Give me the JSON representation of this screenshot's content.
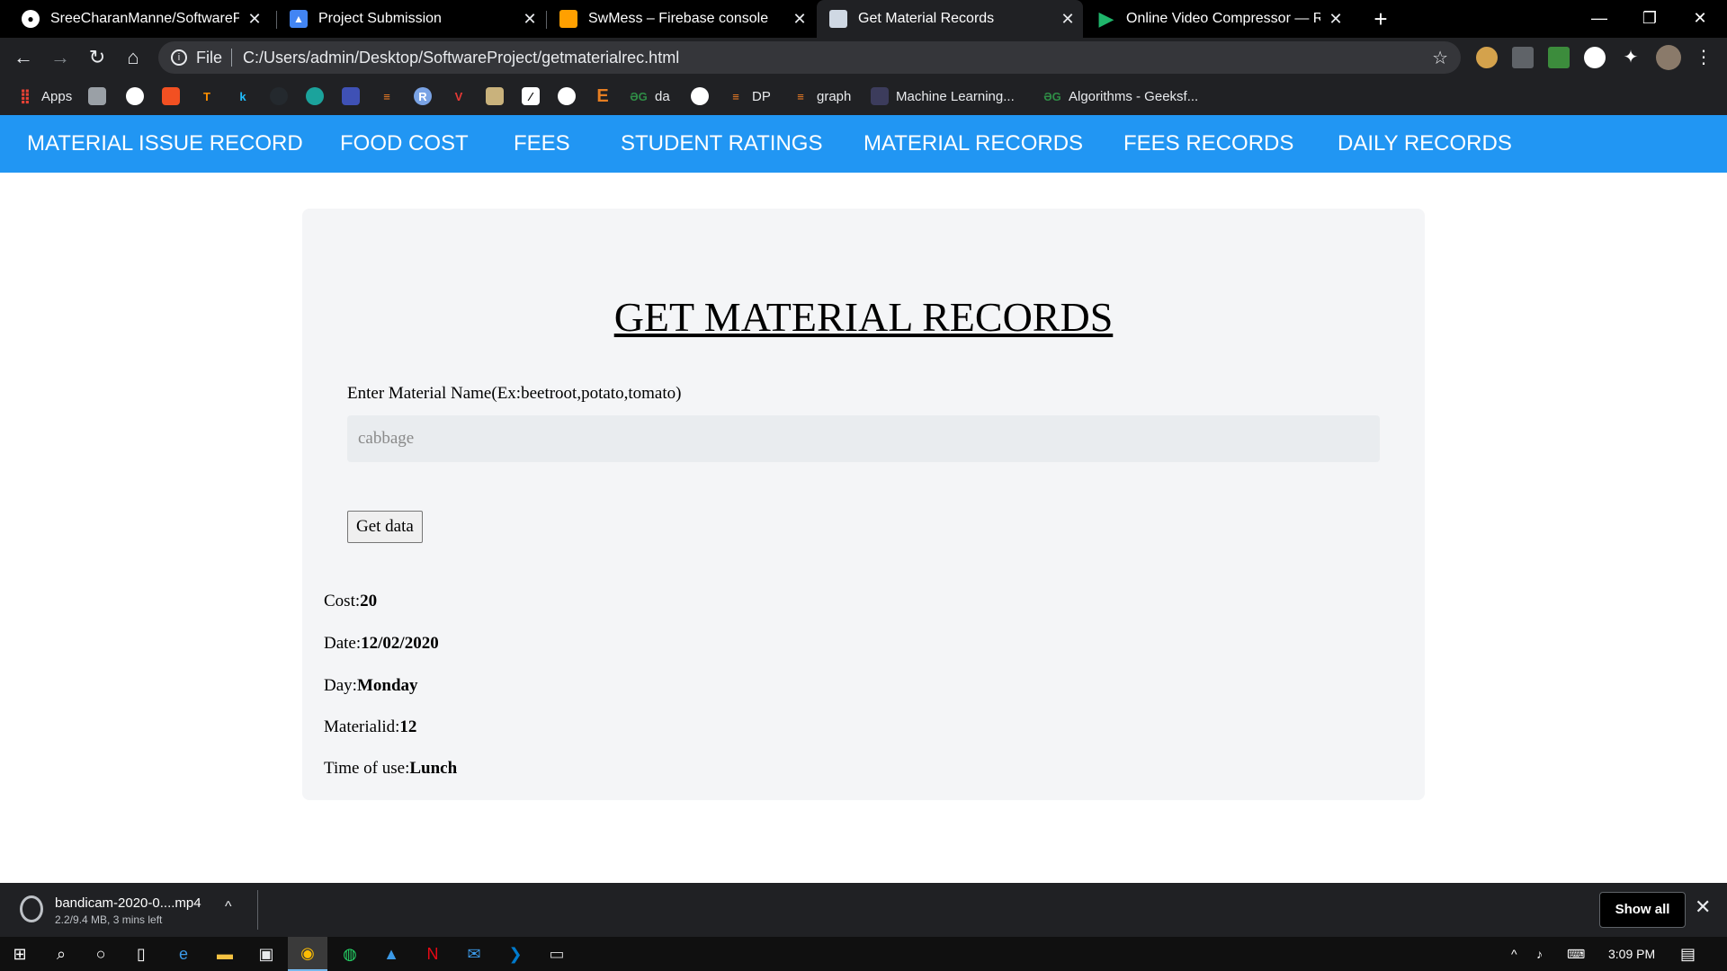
{
  "browser": {
    "tabs": [
      {
        "title": "SreeCharanManne/SoftwareProje",
        "icon": "github-icon"
      },
      {
        "title": "Project Submission",
        "icon": "classroom-icon"
      },
      {
        "title": "SwMess – Firebase console",
        "icon": "firebase-icon"
      },
      {
        "title": "Get Material Records",
        "icon": "page-icon",
        "active": true
      },
      {
        "title": "Online Video Compressor — Red",
        "icon": "play-icon"
      }
    ],
    "address": {
      "scheme": "File",
      "url": "C:/Users/admin/Desktop/SoftwareProject/getmaterialrec.html"
    },
    "bookmarks": [
      {
        "label": "Apps"
      },
      {
        "label": "da"
      },
      {
        "label": "DP"
      },
      {
        "label": "graph"
      },
      {
        "label": "Machine Learning..."
      },
      {
        "label": "Algorithms - Geeksf..."
      }
    ]
  },
  "nav": {
    "items": [
      "MATERIAL ISSUE RECORD",
      "FOOD COST",
      "FEES",
      "STUDENT RATINGS",
      "MATERIAL RECORDS",
      "FEES RECORDS",
      "DAILY RECORDS"
    ]
  },
  "form": {
    "heading": "GET MATERIAL RECORDS",
    "label": "Enter Material Name(Ex:beetroot,potato,tomato)",
    "input_placeholder": "cabbage",
    "button_label": "Get data"
  },
  "result": {
    "cost_label": "Cost:",
    "cost": "20",
    "date_label": "Date:",
    "date": "12/02/2020",
    "day_label": "Day:",
    "day": "Monday",
    "materialid_label": "Materialid:",
    "materialid": "12",
    "time_label": "Time of use:",
    "time": "Lunch"
  },
  "downloads": {
    "file_name": "bandicam-2020-0....mp4",
    "status": "2.2/9.4 MB, 3 mins left",
    "show_all": "Show all"
  },
  "taskbar": {
    "clock": "3:09 PM"
  },
  "colors": {
    "nav_bg": "#2196f3",
    "card_bg": "#f4f5f7",
    "input_bg": "#e9ecef"
  }
}
